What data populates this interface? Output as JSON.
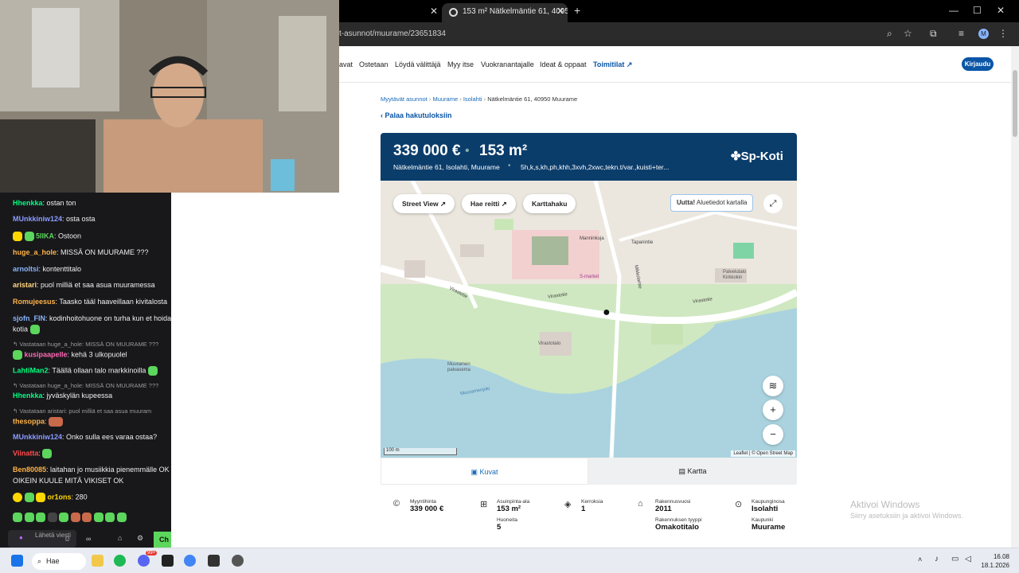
{
  "browser": {
    "tab_title": "153 m² Nätkelmäntie 61, 40950",
    "url": "t-asunnot/muurame/23651834",
    "avatar_letter": "M"
  },
  "nav": {
    "items": [
      "avat",
      "Ostetaan",
      "Löydä välittäjä",
      "Myy itse",
      "Vuokranantajalle",
      "Ideat & oppaat",
      "Toimitilat"
    ],
    "login": "Kirjaudu"
  },
  "breadcrumb": {
    "items": [
      "Myytävät asunnot",
      "Muurame",
      "Isolahti"
    ],
    "current": "Nätkelmäntie 61, 40950 Muurame"
  },
  "back_link": "Palaa hakutuloksiin",
  "listing": {
    "price": "339 000 €",
    "area": "153 m²",
    "address": "Nätkelmäntie 61, Isolahti, Muurame",
    "rooms": "5h,k,s,kh,ph,khh,3xvh,2xwc,tekn.t/var.,kuisti+ter...",
    "brand": "Sp-Koti"
  },
  "map": {
    "street_view": "Street View",
    "route": "Hae reitti",
    "map_search": "Karttahaku",
    "new_label": "Uutta!",
    "new_text": "Aluetiedot kartalla",
    "scale": "100 m",
    "attribution": "Leaflet | © Open Street Map",
    "streets": [
      "Virastotie",
      "Virastotie",
      "Virastotie",
      "Manninkuja",
      "Tapanintie",
      "Mikkolantie",
      "Muuramenjoki"
    ],
    "places": [
      "S-market",
      "Virastotalo",
      "Muuramen palvasema",
      "Palvelutalo Kirkkokin"
    ]
  },
  "view_tabs": {
    "photos": "Kuvat",
    "map": "Kartta"
  },
  "facts": [
    {
      "label": "Myyntihinta",
      "value": "339 000 €"
    },
    {
      "label": "Asuinpinta-ala",
      "value": "153 m²"
    },
    {
      "label": "Huoneita",
      "value": "5"
    },
    {
      "label": "Kerroksia",
      "value": "1"
    },
    {
      "label": "Rakennusvuosi",
      "value": "2011"
    },
    {
      "label": "Rakennuksen tyyppi",
      "value": "Omakotitalo"
    },
    {
      "label": "Kaupunginosa",
      "value": "Isolahti"
    },
    {
      "label": "Kaupunki",
      "value": "Muurame"
    }
  ],
  "windows_activation": {
    "title": "Aktivoi Windows",
    "subtitle": "Siirry asetuksiin ja aktivoi Windows."
  },
  "chat": {
    "messages": [
      {
        "user": "Hhenkka",
        "color": "#00ff7f",
        "text": ": ostan ton"
      },
      {
        "user": "MUnkkiniw124",
        "color": "#8a9cff",
        "text": ": osta osta"
      },
      {
        "user": "5IIKA",
        "color": "#5cd65c",
        "text": ": Ostoon"
      },
      {
        "user": "huge_a_hole",
        "color": "#ffb347",
        "text": ": MISSÄ ON MUURAME ???"
      },
      {
        "user": "arnoltsi",
        "color": "#8ab4f8",
        "text": ": kontenttitalo"
      },
      {
        "user": "aristari",
        "color": "#ffd580",
        "text": ": puol milliä et saa asua muuramessa"
      },
      {
        "user": "Romujeesus",
        "color": "#ffb347",
        "text": ": Taasko tääl haaveillaan kivitalosta"
      },
      {
        "user": "sjofn_FIN",
        "color": "#8ab4f8",
        "text": ": kodinhoitohuone on turha kun et hoida"
      },
      {
        "user": "",
        "color": "#efeff1",
        "text": "kotia"
      },
      {
        "user": "kusipaapelle",
        "color": "#ff69b4",
        "text": ": kehä 3 ulkopuolel"
      },
      {
        "user": "LahtiMan2",
        "color": "#00ff7f",
        "text": ": Täällä ollaan talo markkinoilla"
      },
      {
        "user": "Hhenkka",
        "color": "#00ff7f",
        "text": ": jyväskylän kupeessa"
      },
      {
        "user": "thesoppa",
        "color": "#ffb347",
        "text": ":"
      },
      {
        "user": "MUnkkiniw124",
        "color": "#8a9cff",
        "text": ": Onko sulla ees varaa ostaa?"
      },
      {
        "user": "Viinatta",
        "color": "#ff4d4d",
        "text": ":"
      },
      {
        "user": "Ben80085",
        "color": "#ffb347",
        "text": ": laitahan jo musiikkia pienemmälle OK"
      },
      {
        "user": "",
        "color": "#efeff1",
        "text": "OIKEIN KUULE MITÄ VIKISET OK"
      },
      {
        "user": "or1ons",
        "color": "#ffd700",
        "text": ": 280"
      }
    ],
    "replies": [
      "Vastataan huge_a_hole: MISSÄ ON MUURAME ???",
      "Vastataan huge_a_hole: MISSÄ ON MUURAME ???",
      "Vastataan aristari: puol milliä et saa asua muuram"
    ],
    "input_placeholder": "Lähetä viesti",
    "send_label": "Ch"
  },
  "taskbar": {
    "search": "Hae",
    "time": "16.08",
    "date": "18.1.2026",
    "badge": "99+"
  },
  "colors": {
    "brand": "#0b3d6b",
    "link": "#1a6ab8",
    "login": "#0a55a6"
  }
}
